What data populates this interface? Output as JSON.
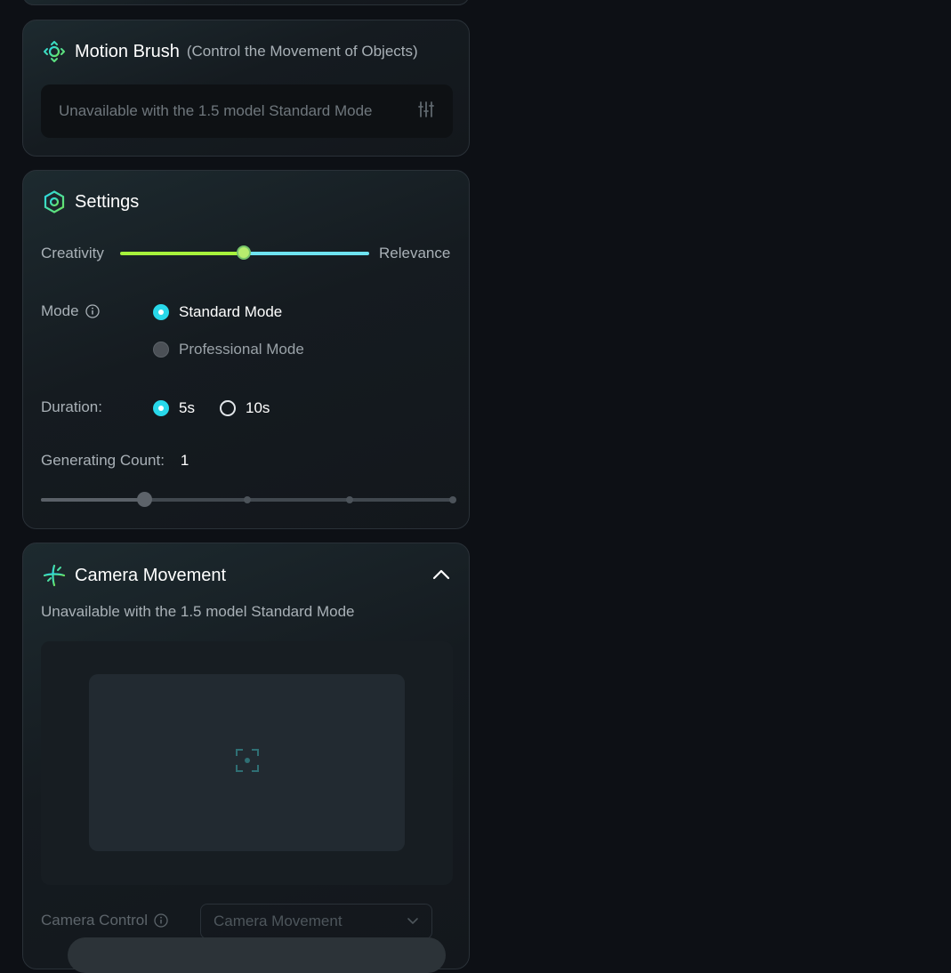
{
  "motion_brush": {
    "title": "Motion Brush",
    "subtitle": "(Control the Movement of Objects)",
    "notice": "Unavailable with the 1.5 model Standard Mode"
  },
  "settings": {
    "title": "Settings",
    "creativity_label": "Creativity",
    "relevance_label": "Relevance",
    "creativity_relevance_value": 0.5,
    "mode_label": "Mode",
    "mode_options": [
      {
        "label": "Standard Mode",
        "selected": true
      },
      {
        "label": "Professional Mode",
        "selected": false
      }
    ],
    "duration_label": "Duration:",
    "duration_options": [
      {
        "label": "5s",
        "selected": true
      },
      {
        "label": "10s",
        "selected": false
      }
    ],
    "count_label": "Generating Count:",
    "count_value": "1",
    "count_steps": 5,
    "count_selected_index": 1
  },
  "camera": {
    "title": "Camera Movement",
    "notice": "Unavailable with the 1.5 model Standard Mode",
    "control_label": "Camera Control",
    "select_value": "Camera Movement"
  },
  "colors": {
    "accent_cyan": "#28d8ea",
    "accent_green": "#a7f23c",
    "icon_green": "#3fd6a8"
  }
}
